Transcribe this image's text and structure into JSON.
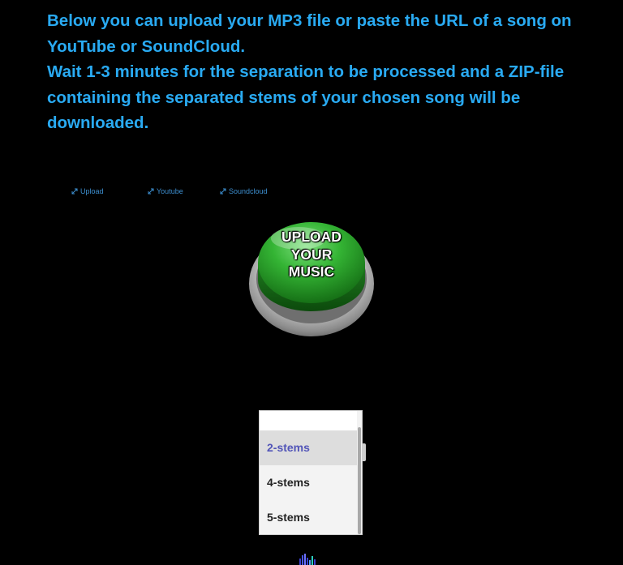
{
  "intro": {
    "line1": "Below you can upload your MP3 file or paste the URL of a song on YouTube or SoundCloud.",
    "line2": "Wait 1-3 minutes for the separation to be processed and a ZIP-file containing the separated stems of your chosen song will be downloaded."
  },
  "tabs": [
    {
      "label": "Upload",
      "icon": "expand-arrow-icon"
    },
    {
      "label": "Youtube",
      "icon": "expand-arrow-icon"
    },
    {
      "label": "Soundcloud",
      "icon": "expand-arrow-icon"
    }
  ],
  "upload_button": {
    "label": "UPLOAD\nYOUR\nMUSIC"
  },
  "stems": {
    "options": [
      "2-stems",
      "4-stems",
      "5-stems"
    ],
    "selected": "2-stems"
  },
  "colors": {
    "background": "#000000",
    "intro_text": "#29aaf2",
    "tab_text": "#3d8fd0",
    "button_green": "#2fa52f",
    "selected_option": "#5255b8"
  }
}
